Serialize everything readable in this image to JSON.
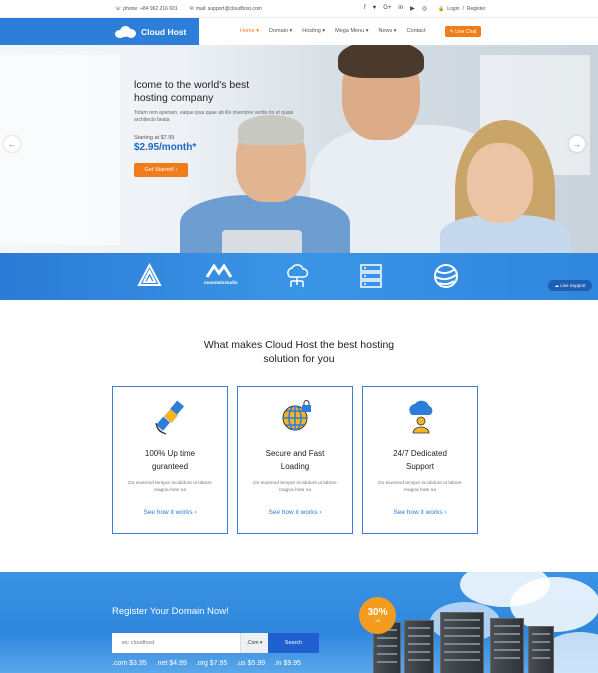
{
  "topbar": {
    "phone": "phone: +84 962 216 601",
    "email": "mail: support@cloudhost.com",
    "social_icons": [
      "facebook-icon",
      "twitter-icon",
      "google-plus-icon",
      "linkedin-icon",
      "youtube-icon",
      "instagram-icon"
    ],
    "social_glyphs": [
      "f",
      "♥",
      "G+",
      "in",
      "▶",
      "◎"
    ],
    "login": "Login",
    "separator": "/",
    "register": "Register"
  },
  "header": {
    "logo_text": "Cloud Host",
    "nav": [
      {
        "label": "Home ▾",
        "active": true
      },
      {
        "label": "Domain ▾",
        "active": false
      },
      {
        "label": "Hosting ▾",
        "active": false
      },
      {
        "label": "Mega Menu ▾",
        "active": false
      },
      {
        "label": "News ▾",
        "active": false
      },
      {
        "label": "Contact",
        "active": false
      }
    ],
    "live_chat": "Live Chat"
  },
  "hero": {
    "title_line1": "lcome to the world's best",
    "title_line2": "hosting company",
    "subtitle": "Totam rem aperiam, eaque ipsa quae ab illo inventore veritis ito et quasi architecto beata",
    "starting": "Starting at $7.99",
    "price": "$2.95/month*",
    "cta": "Get Started!  ›",
    "prev": "←",
    "next": "→"
  },
  "partners": {
    "items": [
      "triangle-logo",
      "mountainstudio-logo",
      "cloud-network-logo",
      "server-logo",
      "globe-logo"
    ],
    "caption": "mountainstudio"
  },
  "live_support": "Live Support",
  "features": {
    "title_line1": "What makes Cloud Host the best hosting",
    "title_line2": "solution for you",
    "cards": [
      {
        "icon": "satellite-icon",
        "title1": "100% Up time",
        "title2": "guranteed",
        "text": "Do eiusmod tempor incididunt ut labore magna hote na",
        "link": "See how it works  ›"
      },
      {
        "icon": "globe-lock-icon",
        "title1": "Secure and Fast",
        "title2": "Loading",
        "text": "Do eiusmod tempor incididunt ut labore magna hote na",
        "link": "See how it works  ›"
      },
      {
        "icon": "cloud-support-icon",
        "title1": "24/7 Dedicated",
        "title2": "Support",
        "text": "Do eiusmod tempor incididunt ut labore magna hote na",
        "link": "See how it works  ›"
      }
    ]
  },
  "domain": {
    "title": "Register Your Domain Now!",
    "placeholder": "ex: cloudhost",
    "select": ".Com ▾",
    "search": "Search",
    "prices": [
      ".com $3.95",
      ".net $4.99",
      ".org $7.95",
      ".us $5.99",
      ".in $9.95"
    ],
    "promo_pct": "30%",
    "promo_off": "off"
  },
  "colors": {
    "brand_blue": "#2c7ed8",
    "accent_orange": "#f07c1a"
  }
}
